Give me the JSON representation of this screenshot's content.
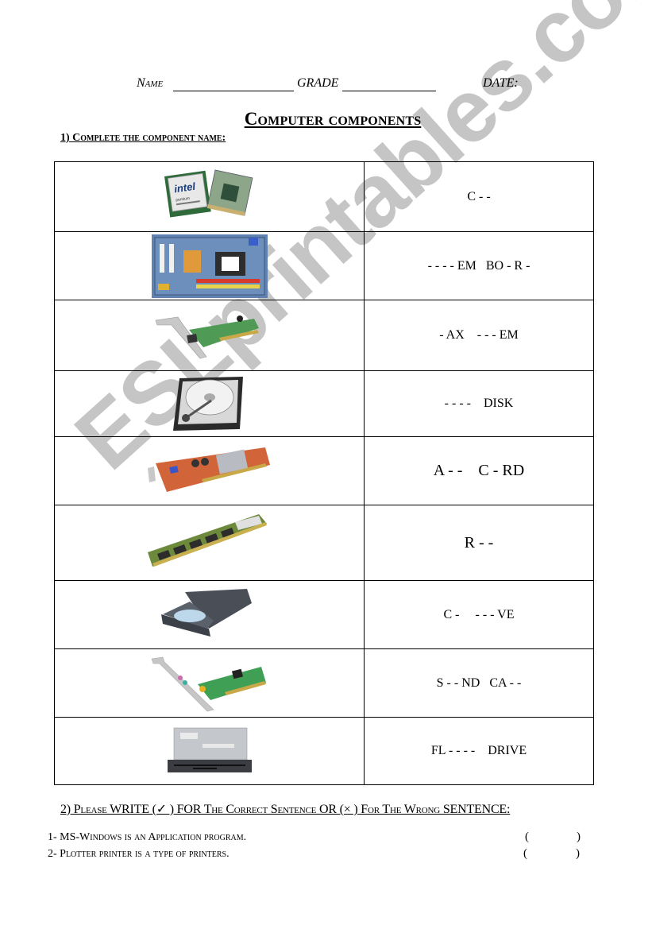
{
  "header": {
    "name_label": "Name",
    "grade_label": "GRADE",
    "date_label": "DATE:"
  },
  "title": "Computer components",
  "section1": {
    "heading": "1) Complete the component name:",
    "rows": [
      {
        "image": "cpu-processor-icon",
        "answer": "C - -"
      },
      {
        "image": "motherboard-icon",
        "answer": "- - - - EM   BO - R -"
      },
      {
        "image": "fax-modem-card-icon",
        "answer": "- AX    - - - EM"
      },
      {
        "image": "hard-disk-icon",
        "answer": "- - - -    DISK"
      },
      {
        "image": "graphics-card-icon",
        "answer": "A - -    C - RD"
      },
      {
        "image": "ram-module-icon",
        "answer": "R - -"
      },
      {
        "image": "cd-drive-icon",
        "answer": "C -     - - - VE"
      },
      {
        "image": "sound-card-icon",
        "answer": "S - - ND   CA - -"
      },
      {
        "image": "floppy-drive-icon",
        "answer": "FL - - - -    DRIVE"
      }
    ]
  },
  "section2": {
    "heading": "2) Please WRITE (✓ ) FOR The Correct Sentence OR (× ) For The Wrong SENTENCE:",
    "questions": [
      {
        "text": "1- MS-Windows is an Application program.",
        "open": "(",
        "close": ")"
      },
      {
        "text": "2- Plotter printer is a type of printers.",
        "open": "(",
        "close": ")"
      }
    ]
  },
  "watermark": "ESLprintables.com"
}
